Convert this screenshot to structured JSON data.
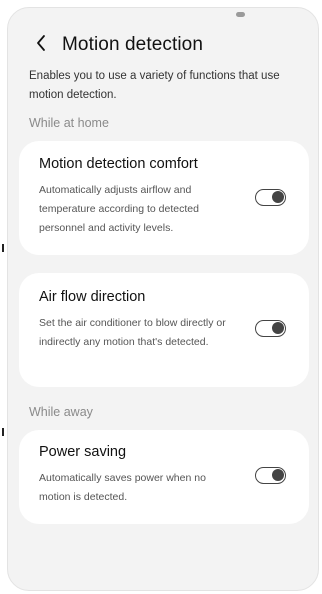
{
  "header": {
    "title": "Motion detection"
  },
  "description": "Enables you to use a variety of functions that use motion detection.",
  "sections": {
    "while_at_home": "While at home",
    "while_away": "While away"
  },
  "cards": [
    {
      "title": "Motion detection comfort",
      "description": "Automatically adjusts airflow and temperature according to detected personnel and activity levels.",
      "toggle_on": false
    },
    {
      "title": "Air flow direction",
      "description": "Set the air conditioner to blow directly or indirectly any motion that's detected.",
      "toggle_on": false
    },
    {
      "title": "Power saving",
      "description": "Automatically saves power when no motion is detected.",
      "toggle_on": false
    }
  ],
  "icons": {
    "back": "chevron-left-icon"
  },
  "colors": {
    "background": "#f3f3f3",
    "card": "#ffffff",
    "toggle_off": "#444444"
  }
}
